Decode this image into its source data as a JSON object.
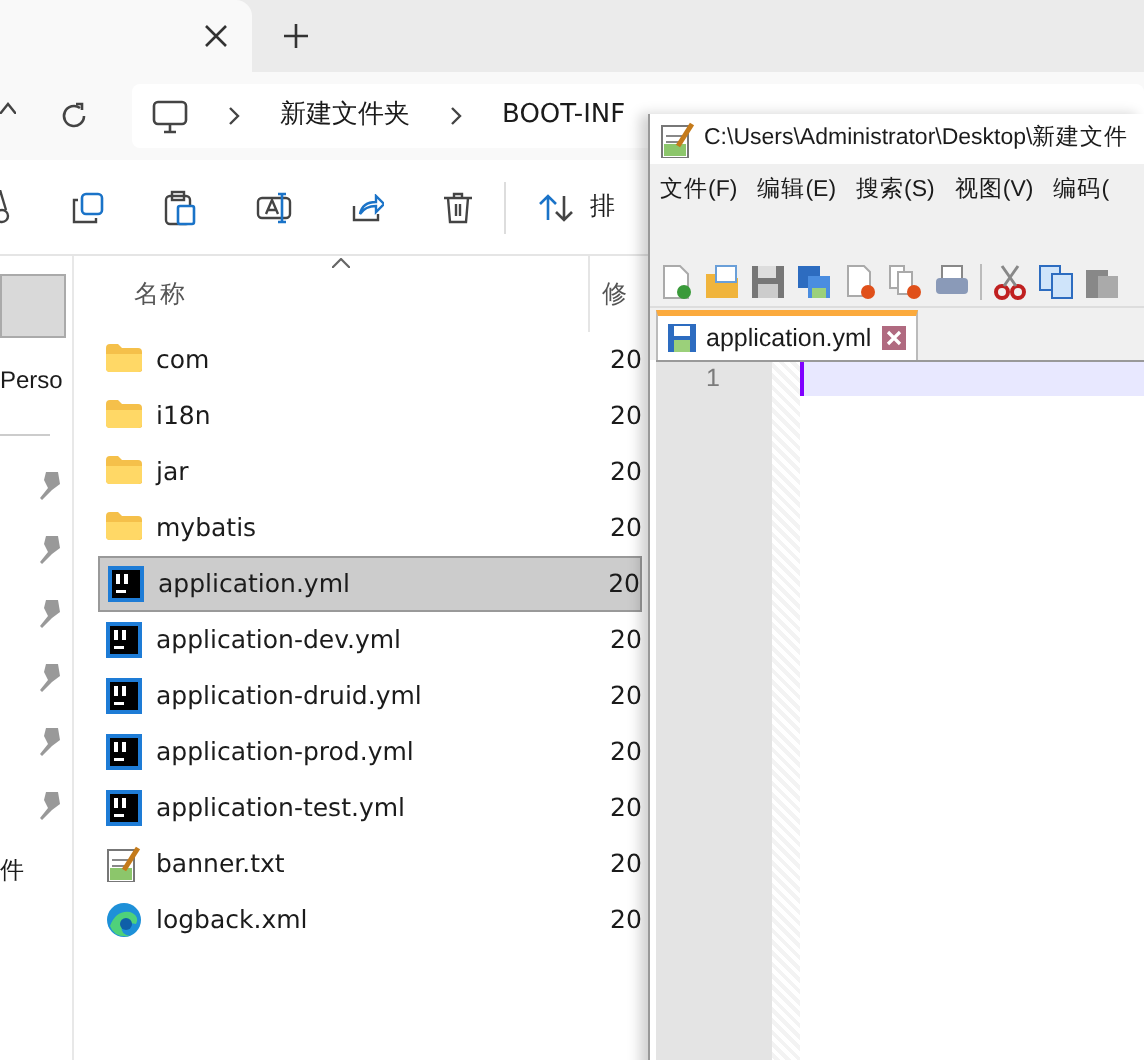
{
  "explorer": {
    "breadcrumb": [
      "新建文件夹",
      "BOOT-INF"
    ],
    "toolbar": {
      "sort_label": "排"
    },
    "nav": [
      {
        "kind": "block",
        "selected": true
      },
      {
        "kind": "text",
        "label": "Perso"
      },
      {
        "kind": "rule"
      },
      {
        "kind": "pin"
      },
      {
        "kind": "pin"
      },
      {
        "kind": "pin"
      },
      {
        "kind": "pin"
      },
      {
        "kind": "pin"
      },
      {
        "kind": "pin"
      },
      {
        "kind": "text",
        "label": "件"
      }
    ],
    "columns": [
      {
        "label": "名称",
        "sorted": true
      },
      {
        "label": "修",
        "sorted": false
      }
    ],
    "files": [
      {
        "name": "com",
        "kind": "folder",
        "date": "20",
        "selected": false
      },
      {
        "name": "i18n",
        "kind": "folder",
        "date": "20",
        "selected": false
      },
      {
        "name": "jar",
        "kind": "folder",
        "date": "20",
        "selected": false
      },
      {
        "name": "mybatis",
        "kind": "folder",
        "date": "20",
        "selected": false
      },
      {
        "name": "application.yml",
        "kind": "ide",
        "date": "20",
        "selected": true
      },
      {
        "name": "application-dev.yml",
        "kind": "ide",
        "date": "20",
        "selected": false
      },
      {
        "name": "application-druid.yml",
        "kind": "ide",
        "date": "20",
        "selected": false
      },
      {
        "name": "application-prod.yml",
        "kind": "ide",
        "date": "20",
        "selected": false
      },
      {
        "name": "application-test.yml",
        "kind": "ide",
        "date": "20",
        "selected": false
      },
      {
        "name": "banner.txt",
        "kind": "text",
        "date": "20",
        "selected": false
      },
      {
        "name": "logback.xml",
        "kind": "browser",
        "date": "20",
        "selected": false
      }
    ]
  },
  "editor": {
    "title": "C:\\Users\\Administrator\\Desktop\\新建文件",
    "menu": [
      "文件(F)",
      "编辑(E)",
      "搜索(S)",
      "视图(V)",
      "编码("
    ],
    "tabs": [
      {
        "label": "application.yml",
        "selected": true
      }
    ],
    "lines": [
      {
        "number": "1",
        "current": true
      }
    ]
  }
}
